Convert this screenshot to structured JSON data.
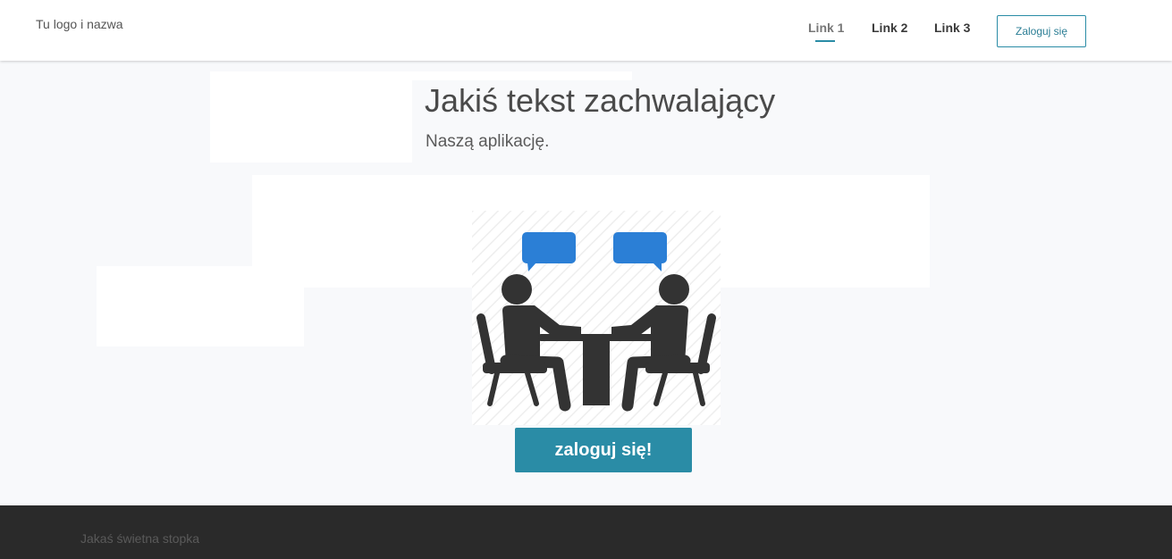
{
  "navbar": {
    "brand": "Tu logo i nazwa",
    "links": [
      {
        "label": "Link 1",
        "active": true
      },
      {
        "label": "Link 2",
        "active": false
      },
      {
        "label": "Link 3",
        "active": false
      }
    ],
    "login_label": "Zaloguj się"
  },
  "hero": {
    "title": "Jakiś tekst zachwalający",
    "subtitle": "Naszą aplikację.",
    "cta_label": "zaloguj się!"
  },
  "illustration": {
    "icon": "meeting-people-icon",
    "colors": {
      "figure": "#333333",
      "bubble": "#2b7fd6"
    }
  },
  "footer": {
    "text": "Jakaś świetna stopka"
  },
  "colors": {
    "accent": "#2a8ca6",
    "footer_bg": "#2a2a2a",
    "page_bg": "#f8f9fb"
  }
}
